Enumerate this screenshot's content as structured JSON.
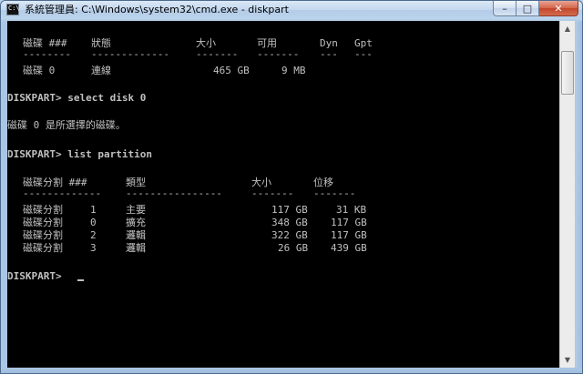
{
  "window": {
    "title": "系統管理員: C:\\Windows\\system32\\cmd.exe - diskpart",
    "icon_label": "C:\\",
    "buttons": {
      "minimize": "–",
      "maximize": "□",
      "close": "✕"
    }
  },
  "console": {
    "disk_header": {
      "disk": "磁碟 ###",
      "status": "狀態",
      "size": "大小",
      "free": "可用",
      "dyn": "Dyn",
      "gpt": "Gpt"
    },
    "disk_separator": {
      "disk": "--------",
      "status": "-------------",
      "size": "-------",
      "free": "-------",
      "dyn": "---",
      "gpt": "---"
    },
    "disk_rows": [
      {
        "disk": "磁碟 0",
        "status": "連線",
        "size": "465 GB",
        "free": "9 MB",
        "dyn": "",
        "gpt": ""
      }
    ],
    "prompt1": "DISKPART> select disk 0",
    "select_message": "磁碟 0 是所選擇的磁碟。",
    "prompt2": "DISKPART> list partition",
    "partition_header": {
      "partition": "磁碟分割 ###",
      "type": "類型",
      "size": "大小",
      "offset": "位移"
    },
    "partition_separator": {
      "partition": "-------------",
      "type": "----------------",
      "size": "-------",
      "offset": "-------"
    },
    "partition_rows": [
      {
        "label": "磁碟分割",
        "num": "1",
        "type": "主要",
        "size": "117 GB",
        "offset": "31 KB"
      },
      {
        "label": "磁碟分割",
        "num": "0",
        "type": "擴充",
        "size": "348 GB",
        "offset": "117 GB"
      },
      {
        "label": "磁碟分割",
        "num": "2",
        "type": "邏輯",
        "size": "322 GB",
        "offset": "117 GB"
      },
      {
        "label": "磁碟分割",
        "num": "3",
        "type": "邏輯",
        "size": "26 GB",
        "offset": "439 GB"
      }
    ],
    "prompt3": "DISKPART> "
  }
}
